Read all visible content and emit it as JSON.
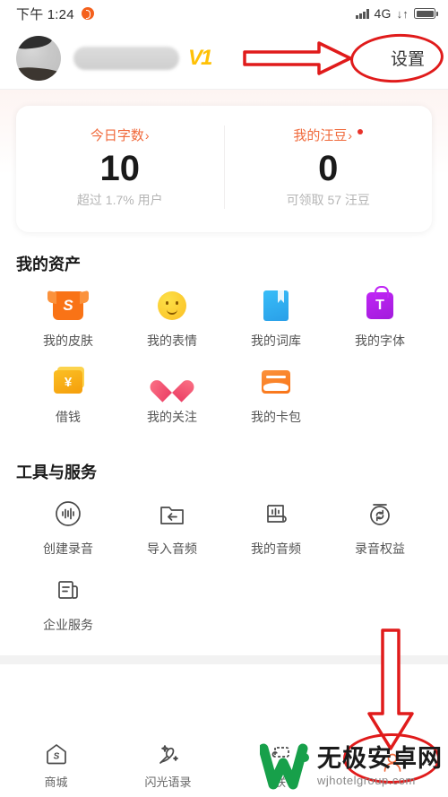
{
  "statusbar": {
    "time": "下午 1:24",
    "notification_icon": "alarm-icon",
    "network": "4G",
    "data_arrows": "↓↑"
  },
  "header": {
    "avatar": "user-avatar",
    "username_redacted": "",
    "level_badge": "V1",
    "settings_label": "设置"
  },
  "stats": {
    "left": {
      "title": "今日字数",
      "chevron": "›",
      "value": "10",
      "sub": "超过 1.7% 用户"
    },
    "right": {
      "title": "我的汪豆",
      "chevron": "›",
      "value": "0",
      "sub": "可领取 57 汪豆",
      "has_red_dot": true
    }
  },
  "assets": {
    "title": "我的资产",
    "items": [
      {
        "label": "我的皮肤",
        "icon": "tshirt-icon",
        "glyph": "S"
      },
      {
        "label": "我的表情",
        "icon": "smiley-icon",
        "glyph": ""
      },
      {
        "label": "我的词库",
        "icon": "book-icon",
        "glyph": ""
      },
      {
        "label": "我的字体",
        "icon": "font-bag-icon",
        "glyph": "T"
      },
      {
        "label": "借钱",
        "icon": "money-card-icon",
        "glyph": "¥"
      },
      {
        "label": "我的关注",
        "icon": "heart-icon",
        "glyph": ""
      },
      {
        "label": "我的卡包",
        "icon": "wallet-card-icon",
        "glyph": ""
      }
    ]
  },
  "tools": {
    "title": "工具与服务",
    "items": [
      {
        "label": "创建录音",
        "icon": "waveform-circle-icon"
      },
      {
        "label": "导入音频",
        "icon": "folder-import-icon"
      },
      {
        "label": "我的音频",
        "icon": "scroll-audio-icon"
      },
      {
        "label": "录音权益",
        "icon": "refresh-rights-icon"
      },
      {
        "label": "企业服务",
        "icon": "enterprise-doc-icon"
      }
    ]
  },
  "bottom_nav": {
    "items": [
      {
        "label": "商城",
        "icon": "store-icon"
      },
      {
        "label": "闪光语录",
        "icon": "sparkle-pen-icon"
      },
      {
        "label": "朕",
        "icon": "keyboard-skin-icon"
      },
      {
        "label": "",
        "icon": "profile-icon"
      }
    ]
  },
  "annotations": {
    "arrow_right": "red-arrow-right",
    "arrow_down": "red-arrow-down",
    "ellipse_settings": "red-ellipse-settings",
    "ellipse_nav": "red-ellipse-bottom-nav",
    "color": "#e01b1b"
  },
  "watermark": {
    "cn": "无极安卓网",
    "en": "wjhotelgroup.com",
    "logo_color": "#17A04A"
  }
}
